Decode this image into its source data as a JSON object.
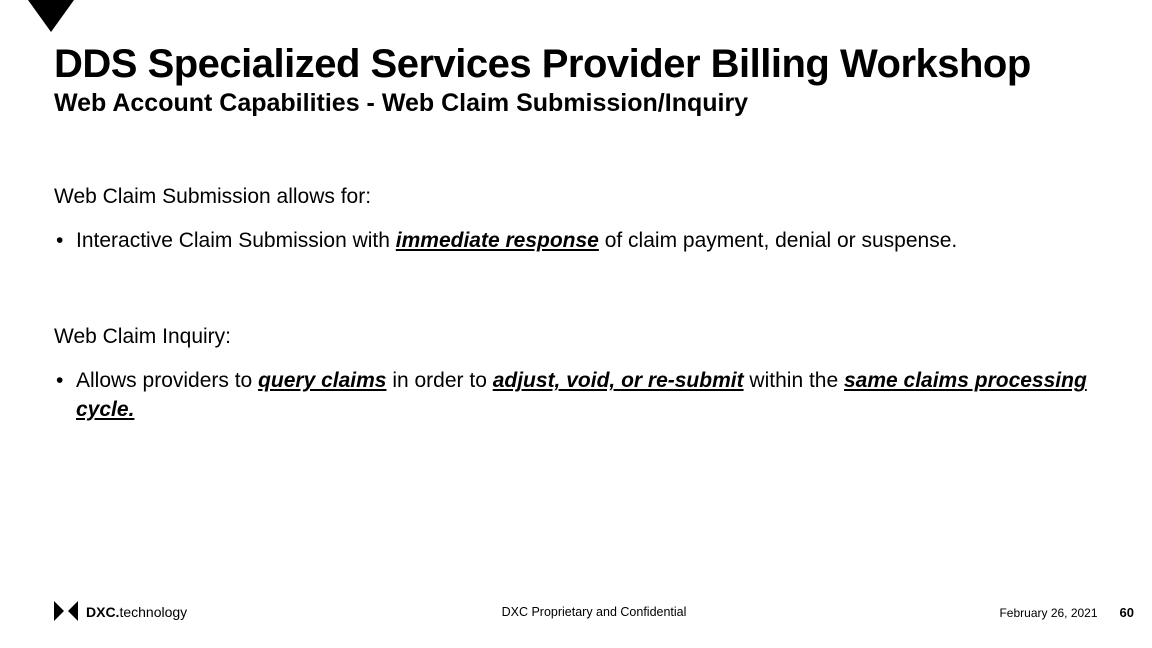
{
  "accent": "#000000",
  "header": {
    "title": "DDS Specialized Services Provider Billing Workshop",
    "subtitle": "Web Account Capabilities - Web Claim Submission/Inquiry"
  },
  "body": {
    "section1_lead": "Web Claim Submission allows for:",
    "bullet1_pre": "Interactive Claim Submission with ",
    "bullet1_em": "immediate response",
    "bullet1_post": " of claim payment, denial or suspense.",
    "section2_lead": "Web Claim Inquiry:",
    "bullet2_pre": "Allows providers to ",
    "bullet2_u1": "query claims",
    "bullet2_mid1": " in order to ",
    "bullet2_u2": "adjust, void, or re-submit",
    "bullet2_mid2": " within the ",
    "bullet2_u3": "same claims processing cycle",
    "bullet2_period": "."
  },
  "footer": {
    "confidential": "DXC Proprietary and Confidential",
    "date": "February 26, 2021",
    "page": "60",
    "logo_bold": "DXC.",
    "logo_thin": "technology"
  }
}
